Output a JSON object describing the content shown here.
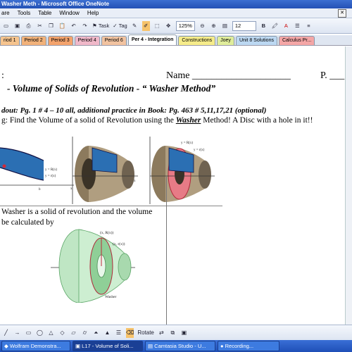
{
  "window": {
    "title": "Washer Meth - Microsoft Office OneNote"
  },
  "menu": {
    "items": [
      "are",
      "Tools",
      "Table",
      "Window",
      "Help"
    ]
  },
  "toolbar": {
    "task_label": "Task",
    "tag_label": "Tag",
    "zoom": "125%",
    "font_size": "12",
    "bold": "B",
    "italic": "A"
  },
  "tabs": [
    {
      "label": "riod 1",
      "color": "#f6c48e"
    },
    {
      "label": "Period 2",
      "color": "#f2b27a"
    },
    {
      "label": "Period 3",
      "color": "#f4a36c"
    },
    {
      "label": "Period 4",
      "color": "#f0b8c9"
    },
    {
      "label": "Period 6",
      "color": "#f2c3a0"
    },
    {
      "label": "Per 4 - Integration",
      "color": "#ffffff"
    },
    {
      "label": "Constructions",
      "color": "#f6ec8a"
    },
    {
      "label": "Joey",
      "color": "#e0ed9b"
    },
    {
      "label": "Unit 8 Solutions",
      "color": "#bcd8f2"
    },
    {
      "label": "Calculus Pr...",
      "color": "#f4a6a6"
    }
  ],
  "page": {
    "colon": ":",
    "name_label": "Name ____________________",
    "period_label": "P.  ___",
    "heading": "-    Volume of Solids of Revolution   -  “ Washer  Method”",
    "handout": "dout:  Pg. 1 # 4 – 10 all, additional practice in Book:  Pg. 463 # 5,11,17,21 (optional)",
    "instruction_a": "g:  Find the Volume of a solid of Revolution using the ",
    "instruction_washer": "Washer",
    "instruction_b": " Method!  A Disc with a hole in it!!",
    "washer_line1": "Washer is a solid of revolution and the volume",
    "washer_line2": "be calculated by"
  },
  "figure_labels": {
    "r1": "y = R(x)",
    "r2": "y = r(x)",
    "r3": "y = R(x)",
    "r4": "y = r(x)",
    "p1": "(x, R(x))",
    "p2": "(x, r(x))",
    "washer": "Washer",
    "axis_x": "x",
    "axis_a": "a",
    "axis_b": "b"
  },
  "drawbar": {
    "rotate": "Rotate"
  },
  "taskbar": {
    "items": [
      {
        "label": "Wolfram Demonstra..."
      },
      {
        "label": "L17 - Volume of Soli..."
      },
      {
        "label": "Camtasia Studio - U..."
      },
      {
        "label": "Recording..."
      }
    ]
  }
}
